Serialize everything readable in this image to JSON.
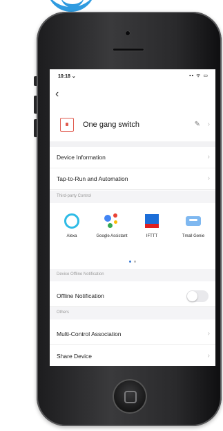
{
  "status_bar": {
    "time": "10:18 ⌄",
    "icons": "▪▪ ᯤ ▭"
  },
  "navigation": {
    "back_glyph": "‹"
  },
  "device": {
    "name": "One gang switch",
    "edit_glyph": "✎",
    "chevron": "›"
  },
  "menu_primary": [
    {
      "label": "Device Information",
      "chevron": "›"
    },
    {
      "label": "Tap-to-Run and Automation",
      "chevron": "›"
    }
  ],
  "sections": {
    "third_party": "Third-party Control",
    "offline": "Device Offline Notification",
    "others": "Others"
  },
  "services": [
    {
      "label": "Alexa",
      "icon": "alexa-icon"
    },
    {
      "label": "Google Assistant",
      "icon": "google-assistant-icon"
    },
    {
      "label": "IFTTT",
      "icon": "ifttt-icon"
    },
    {
      "label": "Tmall Genie",
      "icon": "tmall-genie-icon"
    }
  ],
  "pager": {
    "active_color": "#3a7bd5",
    "inactive_color": "#bbbbbb"
  },
  "offline_notification": {
    "label": "Offline Notification",
    "enabled": false
  },
  "menu_others": [
    {
      "label": "Multi-Control Association",
      "chevron": "›"
    },
    {
      "label": "Share Device",
      "chevron": "›"
    }
  ],
  "colors": {
    "accent": "#e05a4e",
    "alexa": "#2ebbe6",
    "logo": "#2f9be0",
    "google": [
      "#4285f4",
      "#ea4335",
      "#fbbc05",
      "#34a853"
    ]
  }
}
